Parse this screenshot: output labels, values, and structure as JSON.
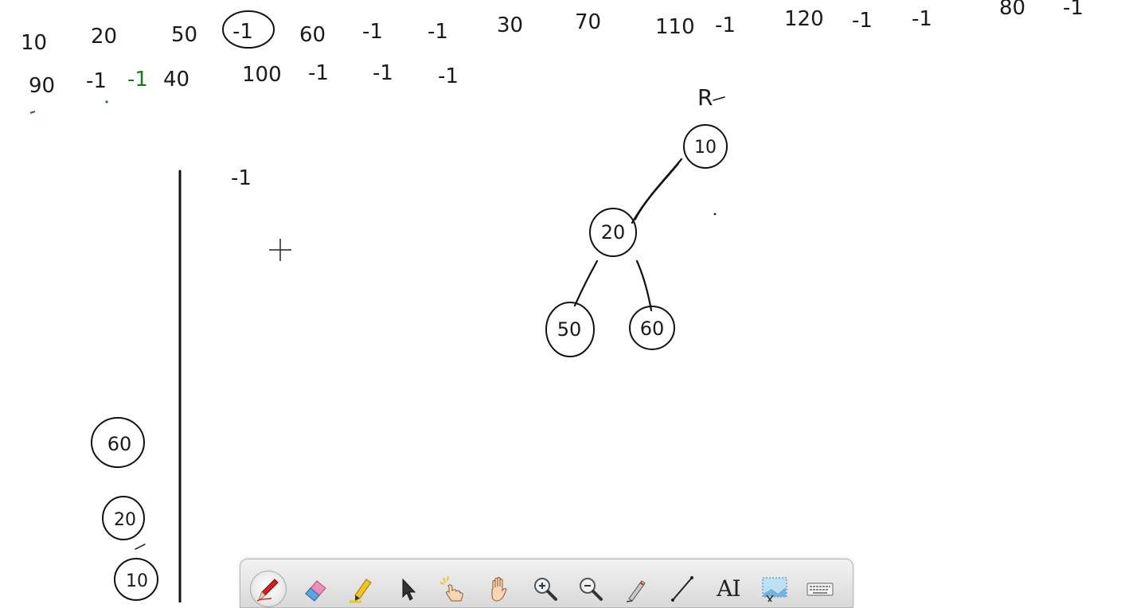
{
  "canvas": {
    "sequence_row1": [
      "10",
      "20",
      "50",
      "-1",
      "60",
      "-1",
      "-1",
      "30",
      "70",
      "110",
      "-1",
      "120",
      "-1",
      "-1",
      "80",
      "-1"
    ],
    "sequence_row2": [
      "90",
      "-1",
      "-1",
      "40",
      "100",
      "-1",
      "-1",
      "-1"
    ],
    "circled_value": "-1",
    "root_label": "R",
    "tree_nodes": [
      "10",
      "20",
      "50",
      "60"
    ],
    "stack_top_note": "-1",
    "stack_items": [
      "60",
      "20",
      "10"
    ],
    "ink_color": "#111111",
    "accent_ink_color": "#1a7a1a"
  },
  "toolbar": {
    "tools": [
      {
        "icon": "red-pen-icon",
        "active": true
      },
      {
        "icon": "eraser-icon",
        "active": false
      },
      {
        "icon": "highlighter-icon",
        "active": false
      },
      {
        "icon": "select-arrow-icon",
        "active": false
      },
      {
        "icon": "laser-pointer-icon",
        "active": false
      },
      {
        "icon": "pan-hand-icon",
        "active": false
      },
      {
        "icon": "zoom-in-icon",
        "active": false
      },
      {
        "icon": "zoom-out-icon",
        "active": false
      },
      {
        "icon": "pen-settings-icon",
        "active": false
      },
      {
        "icon": "line-tool-icon",
        "active": false
      },
      {
        "icon": "text-tool-icon",
        "active": false,
        "label": "AI"
      },
      {
        "icon": "screen-capture-icon",
        "active": false
      },
      {
        "icon": "keyboard-icon",
        "active": false
      }
    ]
  }
}
